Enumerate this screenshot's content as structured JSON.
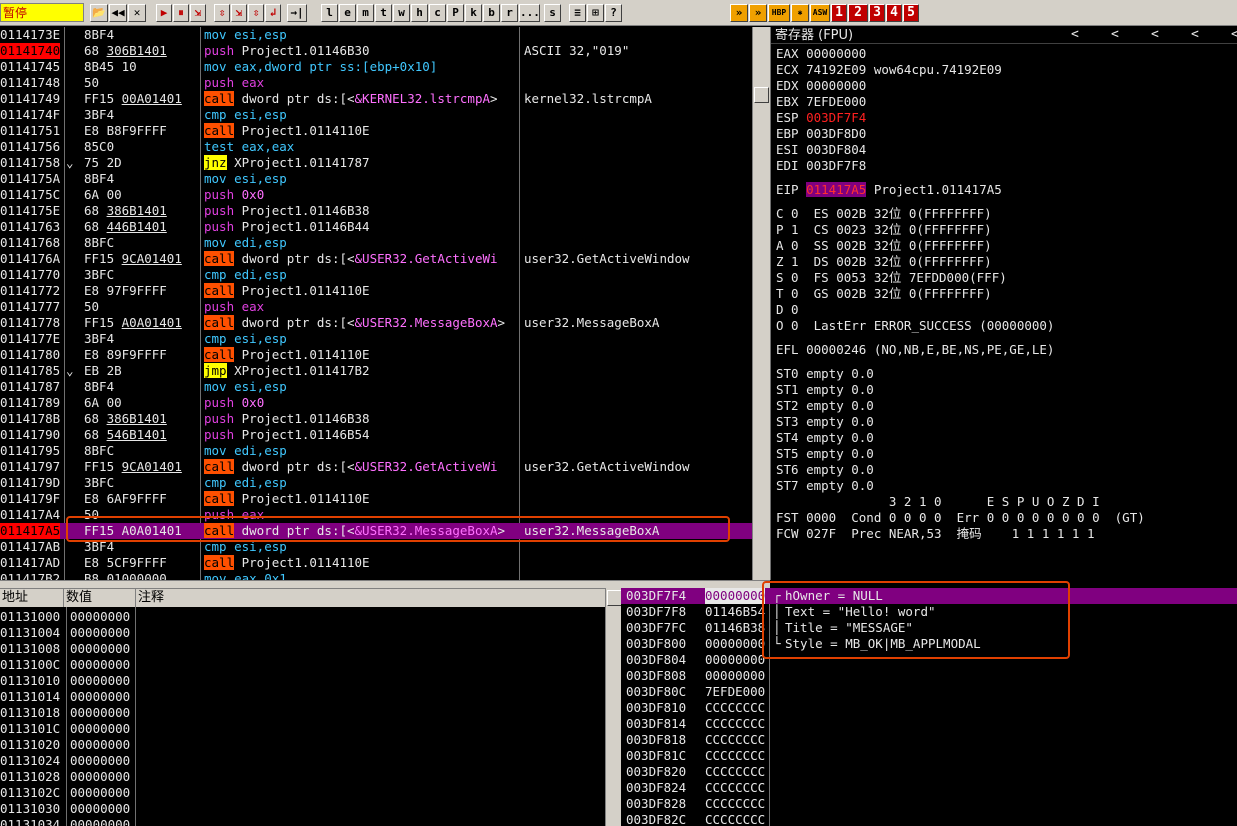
{
  "toolbar": {
    "status": "暂停",
    "buttons": [
      "📂",
      "◀◀",
      "✕",
      "▶",
      "⏸",
      "⇲",
      "⇳",
      "⇲",
      "⇳",
      "↲",
      "→|",
      "l",
      "e",
      "m",
      "t",
      "w",
      "h",
      "c",
      "P",
      "k",
      "b",
      "r",
      "...",
      "s",
      "≡",
      "⊞",
      "?"
    ],
    "right_buttons": [
      "»",
      "»",
      "HBP",
      "✱",
      "ASW",
      "1",
      "2",
      "3",
      "4",
      "5"
    ]
  },
  "cpu": {
    "rows": [
      {
        "addr": "0114173E",
        "hex": "8BF4",
        "asm": [
          [
            "blue",
            "mov esi,esp"
          ]
        ],
        "cmt": ""
      },
      {
        "addr": "01141740",
        "hex": "68 306B1401",
        "hexu": "306B1401",
        "asm": [
          [
            "push",
            "push "
          ],
          [
            "plain",
            "Project1.01146B30"
          ]
        ],
        "cmt": "ASCII 32,\"019\"",
        "cur": true
      },
      {
        "addr": "01141745",
        "hex": "8B45 10",
        "asm": [
          [
            "blue",
            "mov eax,dword ptr ss:[ebp+0x10]"
          ]
        ],
        "cmt": ""
      },
      {
        "addr": "01141748",
        "hex": "50",
        "asm": [
          [
            "push",
            "push eax"
          ]
        ],
        "cmt": ""
      },
      {
        "addr": "01141749",
        "hex": "FF15 00A01401",
        "hexu": "00A01401",
        "asm": [
          [
            "call",
            "call"
          ],
          [
            "plain",
            " dword ptr ds:[<"
          ],
          [
            "api",
            "&KERNEL32.lstrcmpA"
          ],
          [
            "plain",
            ">"
          ]
        ],
        "cmt": "kernel32.lstrcmpA"
      },
      {
        "addr": "0114174F",
        "hex": "3BF4",
        "asm": [
          [
            "blue",
            "cmp esi,esp"
          ]
        ],
        "cmt": ""
      },
      {
        "addr": "01141751",
        "hex": "E8 B8F9FFFF",
        "asm": [
          [
            "call",
            "call"
          ],
          [
            "plain",
            " Project1.0114110E"
          ]
        ],
        "cmt": ""
      },
      {
        "addr": "01141756",
        "hex": "85C0",
        "asm": [
          [
            "blue",
            "test eax,eax"
          ]
        ],
        "cmt": ""
      },
      {
        "addr": "01141758",
        "hex": "75 2D",
        "mark": "⌄",
        "asm": [
          [
            "jmp",
            "jnz"
          ],
          [
            "plain",
            " XProject1.01141787"
          ]
        ],
        "cmt": ""
      },
      {
        "addr": "0114175A",
        "hex": "8BF4",
        "asm": [
          [
            "blue",
            "mov esi,esp"
          ]
        ],
        "cmt": ""
      },
      {
        "addr": "0114175C",
        "hex": "6A 00",
        "asm": [
          [
            "push",
            "push "
          ],
          [
            "imm",
            "0x0"
          ]
        ],
        "cmt": ""
      },
      {
        "addr": "0114175E",
        "hex": "68 386B1401",
        "hexu": "386B1401",
        "asm": [
          [
            "push",
            "push "
          ],
          [
            "plain",
            "Project1.01146B38"
          ]
        ],
        "cmt": ""
      },
      {
        "addr": "01141763",
        "hex": "68 446B1401",
        "hexu": "446B1401",
        "asm": [
          [
            "push",
            "push "
          ],
          [
            "plain",
            "Project1.01146B44"
          ]
        ],
        "cmt": ""
      },
      {
        "addr": "01141768",
        "hex": "8BFC",
        "asm": [
          [
            "blue",
            "mov edi,esp"
          ]
        ],
        "cmt": ""
      },
      {
        "addr": "0114176A",
        "hex": "FF15 9CA01401",
        "hexu": "9CA01401",
        "asm": [
          [
            "call",
            "call"
          ],
          [
            "plain",
            " dword ptr ds:[<"
          ],
          [
            "api",
            "&USER32.GetActiveWi"
          ]
        ],
        "cmt": "user32.GetActiveWindow"
      },
      {
        "addr": "01141770",
        "hex": "3BFC",
        "asm": [
          [
            "blue",
            "cmp edi,esp"
          ]
        ],
        "cmt": ""
      },
      {
        "addr": "01141772",
        "hex": "E8 97F9FFFF",
        "asm": [
          [
            "call",
            "call"
          ],
          [
            "plain",
            " Project1.0114110E"
          ]
        ],
        "cmt": ""
      },
      {
        "addr": "01141777",
        "hex": "50",
        "asm": [
          [
            "push",
            "push eax"
          ]
        ],
        "cmt": ""
      },
      {
        "addr": "01141778",
        "hex": "FF15 A0A01401",
        "hexu": "A0A01401",
        "asm": [
          [
            "call",
            "call"
          ],
          [
            "plain",
            " dword ptr ds:[<"
          ],
          [
            "api",
            "&USER32.MessageBoxA"
          ],
          [
            "plain",
            ">"
          ]
        ],
        "cmt": "user32.MessageBoxA"
      },
      {
        "addr": "0114177E",
        "hex": "3BF4",
        "asm": [
          [
            "blue",
            "cmp esi,esp"
          ]
        ],
        "cmt": ""
      },
      {
        "addr": "01141780",
        "hex": "E8 89F9FFFF",
        "asm": [
          [
            "call",
            "call"
          ],
          [
            "plain",
            " Project1.0114110E"
          ]
        ],
        "cmt": ""
      },
      {
        "addr": "01141785",
        "hex": "EB 2B",
        "mark": "⌄",
        "asm": [
          [
            "jmp",
            "jmp"
          ],
          [
            "plain",
            " XProject1.011417B2"
          ]
        ],
        "cmt": ""
      },
      {
        "addr": "01141787",
        "hex": "8BF4",
        "asm": [
          [
            "blue",
            "mov esi,esp"
          ]
        ],
        "cmt": ""
      },
      {
        "addr": "01141789",
        "hex": "6A 00",
        "asm": [
          [
            "push",
            "push "
          ],
          [
            "imm",
            "0x0"
          ]
        ],
        "cmt": ""
      },
      {
        "addr": "0114178B",
        "hex": "68 386B1401",
        "hexu": "386B1401",
        "asm": [
          [
            "push",
            "push "
          ],
          [
            "plain",
            "Project1.01146B38"
          ]
        ],
        "cmt": ""
      },
      {
        "addr": "01141790",
        "hex": "68 546B1401",
        "hexu": "546B1401",
        "asm": [
          [
            "push",
            "push "
          ],
          [
            "plain",
            "Project1.01146B54"
          ]
        ],
        "cmt": ""
      },
      {
        "addr": "01141795",
        "hex": "8BFC",
        "asm": [
          [
            "blue",
            "mov edi,esp"
          ]
        ],
        "cmt": ""
      },
      {
        "addr": "01141797",
        "hex": "FF15 9CA01401",
        "hexu": "9CA01401",
        "asm": [
          [
            "call",
            "call"
          ],
          [
            "plain",
            " dword ptr ds:[<"
          ],
          [
            "api",
            "&USER32.GetActiveWi"
          ]
        ],
        "cmt": "user32.GetActiveWindow"
      },
      {
        "addr": "0114179D",
        "hex": "3BFC",
        "asm": [
          [
            "blue",
            "cmp edi,esp"
          ]
        ],
        "cmt": ""
      },
      {
        "addr": "0114179F",
        "hex": "E8 6AF9FFFF",
        "asm": [
          [
            "call",
            "call"
          ],
          [
            "plain",
            " Project1.0114110E"
          ]
        ],
        "cmt": ""
      },
      {
        "addr": "011417A4",
        "hex": "50",
        "asm": [
          [
            "push",
            "push eax"
          ]
        ],
        "cmt": ""
      },
      {
        "addr": "011417A5",
        "hex": "FF15 A0A01401",
        "asm": [
          [
            "call",
            "call"
          ],
          [
            "plain",
            " dword ptr ds:[<"
          ],
          [
            "api",
            "&USER32.MessageBoxA"
          ],
          [
            "plain",
            ">"
          ]
        ],
        "cmt": "user32.MessageBoxA",
        "sel": true,
        "cur": true
      },
      {
        "addr": "011417AB",
        "hex": "3BF4",
        "asm": [
          [
            "blue",
            "cmp esi,esp"
          ]
        ],
        "cmt": ""
      },
      {
        "addr": "011417AD",
        "hex": "E8 5CF9FFFF",
        "asm": [
          [
            "call",
            "call"
          ],
          [
            "plain",
            " Project1.0114110E"
          ]
        ],
        "cmt": ""
      },
      {
        "addr": "011417B2",
        "hex": "B8 01000000",
        "asm": [
          [
            "blue",
            "mov eax,0x1"
          ]
        ],
        "cmt": ""
      }
    ]
  },
  "regs": {
    "title": "寄存器 (FPU)",
    "arrows": [
      "<",
      "<",
      "<",
      "<",
      "<"
    ],
    "lines": [
      {
        "t": "EAX 00000000"
      },
      {
        "t": "ECX 74192E09 wow64cpu.74192E09"
      },
      {
        "t": "EDX 00000000"
      },
      {
        "t": "EBX 7EFDE000"
      },
      {
        "t": "ESP ",
        "r": "003DF7F4"
      },
      {
        "t": "EBP 003DF8D0"
      },
      {
        "t": "ESI 003DF804"
      },
      {
        "t": "EDI 003DF7F8"
      },
      {
        "t": ""
      },
      {
        "t": "EIP ",
        "e": "011417A5",
        "t2": " Project1.011417A5"
      },
      {
        "t": ""
      },
      {
        "t": "C 0  ES 002B 32位 0(FFFFFFFF)"
      },
      {
        "t": "P 1  CS 0023 32位 0(FFFFFFFF)"
      },
      {
        "t": "A 0  SS 002B 32位 0(FFFFFFFF)"
      },
      {
        "t": "Z 1  DS 002B 32位 0(FFFFFFFF)"
      },
      {
        "t": "S 0  FS 0053 32位 7EFDD000(FFF)"
      },
      {
        "t": "T 0  GS 002B 32位 0(FFFFFFFF)"
      },
      {
        "t": "D 0"
      },
      {
        "t": "O 0  LastErr ERROR_SUCCESS (00000000)"
      },
      {
        "t": ""
      },
      {
        "t": "EFL 00000246 (NO,NB,E,BE,NS,PE,GE,LE)"
      },
      {
        "t": ""
      },
      {
        "t": "ST0 empty 0.0"
      },
      {
        "t": "ST1 empty 0.0"
      },
      {
        "t": "ST2 empty 0.0"
      },
      {
        "t": "ST3 empty 0.0"
      },
      {
        "t": "ST4 empty 0.0"
      },
      {
        "t": "ST5 empty 0.0"
      },
      {
        "t": "ST6 empty 0.0"
      },
      {
        "t": "ST7 empty 0.0"
      },
      {
        "t": "               3 2 1 0      E S P U O Z D I"
      },
      {
        "t": "FST 0000  Cond 0 0 0 0  Err 0 0 0 0 0 0 0 0  (GT)"
      },
      {
        "t": "FCW 027F  Prec NEAR,53  掩码    1 1 1 1 1 1"
      }
    ]
  },
  "dump": {
    "headers": [
      "地址",
      "数值",
      "注释"
    ],
    "rows": [
      [
        "01131000",
        "00000000"
      ],
      [
        "01131004",
        "00000000"
      ],
      [
        "01131008",
        "00000000"
      ],
      [
        "0113100C",
        "00000000"
      ],
      [
        "01131010",
        "00000000"
      ],
      [
        "01131014",
        "00000000"
      ],
      [
        "01131018",
        "00000000"
      ],
      [
        "0113101C",
        "00000000"
      ],
      [
        "01131020",
        "00000000"
      ],
      [
        "01131024",
        "00000000"
      ],
      [
        "01131028",
        "00000000"
      ],
      [
        "0113102C",
        "00000000"
      ],
      [
        "01131030",
        "00000000"
      ],
      [
        "01131034",
        "00000000"
      ]
    ]
  },
  "stack": {
    "rows": [
      {
        "a": "003DF7F4",
        "v": "00000000",
        "c": "hOwner = NULL",
        "p": "┌",
        "sel": true
      },
      {
        "a": "003DF7F8",
        "v": "01146B54",
        "c": "Text = \"Hello! word\"",
        "p": "│"
      },
      {
        "a": "003DF7FC",
        "v": "01146B38",
        "c": "Title = \"MESSAGE\"",
        "p": "│"
      },
      {
        "a": "003DF800",
        "v": "00000000",
        "c": "Style = MB_OK|MB_APPLMODAL",
        "p": "└"
      },
      {
        "a": "003DF804",
        "v": "00000000",
        "c": "",
        "p": ""
      },
      {
        "a": "003DF808",
        "v": "00000000",
        "c": "",
        "p": ""
      },
      {
        "a": "003DF80C",
        "v": "7EFDE000",
        "c": "",
        "p": ""
      },
      {
        "a": "003DF810",
        "v": "CCCCCCCC",
        "c": "",
        "p": ""
      },
      {
        "a": "003DF814",
        "v": "CCCCCCCC",
        "c": "",
        "p": ""
      },
      {
        "a": "003DF818",
        "v": "CCCCCCCC",
        "c": "",
        "p": ""
      },
      {
        "a": "003DF81C",
        "v": "CCCCCCCC",
        "c": "",
        "p": ""
      },
      {
        "a": "003DF820",
        "v": "CCCCCCCC",
        "c": "",
        "p": ""
      },
      {
        "a": "003DF824",
        "v": "CCCCCCCC",
        "c": "",
        "p": ""
      },
      {
        "a": "003DF828",
        "v": "CCCCCCCC",
        "c": "",
        "p": ""
      },
      {
        "a": "003DF82C",
        "v": "CCCCCCCC",
        "c": "",
        "p": ""
      }
    ]
  }
}
